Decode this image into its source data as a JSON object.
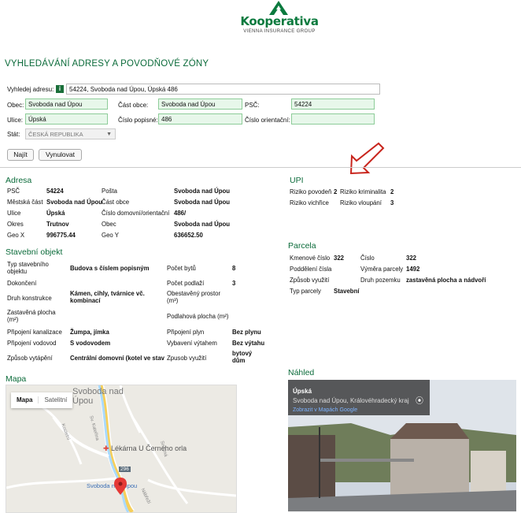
{
  "brand": {
    "name": "Kooperativa",
    "subtitle": "VIENNA INSURANCE GROUP",
    "accent": "#0b7a3e"
  },
  "page_title": "VYHLEDÁVÁNÍ ADRESY A POVODŇOVÉ ZÓNY",
  "search": {
    "address_label": "Vyhledej adresu:",
    "info_icon": "i",
    "address_value": "54224, Svoboda nad Úpou, Úpská 486",
    "obec_label": "Obec:",
    "obec_value": "Svoboda nad Úpou",
    "cast_obce_label": "Část obce:",
    "cast_obce_value": "Svoboda nad Úpou",
    "psc_label": "PSČ:",
    "psc_value": "54224",
    "ulice_label": "Ulice:",
    "ulice_value": "Úpská",
    "cislo_popisne_label": "Číslo popisné:",
    "cislo_popisne_value": "486",
    "cislo_orientacni_label": "Číslo orientační:",
    "cislo_orientacni_value": "",
    "stat_label": "Stát:",
    "stat_value": "ČESKÁ REPUBLIKA",
    "find_button": "Najít",
    "reset_button": "Vynulovat"
  },
  "adresa": {
    "title": "Adresa",
    "rows": [
      {
        "k1": "PSČ",
        "v1": "54224",
        "k2": "Pošta",
        "v2": "Svoboda nad Úpou"
      },
      {
        "k1": "Městská část",
        "v1": "Svoboda nad Úpou",
        "k2": "Část obce",
        "v2": "Svoboda nad Úpou"
      },
      {
        "k1": "Ulice",
        "v1": "Úpská",
        "k2": "Číslo domovní/orientační",
        "v2": "486/"
      },
      {
        "k1": "Okres",
        "v1": "Trutnov",
        "k2": "Obec",
        "v2": "Svoboda nad Úpou"
      },
      {
        "k1": "Geo X",
        "v1": "996775.44",
        "k2": "Geo Y",
        "v2": "636652.50"
      }
    ]
  },
  "upi": {
    "title": "UPI",
    "rows": [
      {
        "k1": "Riziko povodeň",
        "v1": "2",
        "k2": "Riziko kriminalita",
        "v2": "2"
      },
      {
        "k1": "Riziko vichřice",
        "v1": "",
        "k2": "Riziko vloupání",
        "v2": "3"
      }
    ]
  },
  "parcela": {
    "title": "Parcela",
    "rows": [
      {
        "k1": "Kmenové číslo",
        "v1": "322",
        "k2": "Číslo",
        "v2": "322"
      },
      {
        "k1": "Poddělení čísla",
        "v1": "",
        "k2": "Výměra parcely",
        "v2": "1492"
      },
      {
        "k1": "Způsob využití",
        "v1": "",
        "k2": "Druh pozemku",
        "v2": "zastavěná plocha a nádvoří"
      },
      {
        "k1": "Typ parcely",
        "v1": "Stavební",
        "k2": "",
        "v2": ""
      }
    ]
  },
  "stavebni": {
    "title": "Stavební objekt",
    "typ_label": "Typ stavebního objektu",
    "typ_value": "Budova s číslem popisným",
    "pocet_bytu_label": "Počet bytů",
    "pocet_bytu_value": "8",
    "dokonceni_label": "Dokončení",
    "pocet_podlazi_label": "Počet podlaží",
    "pocet_podlazi_value": "3",
    "druh_konstrukce_label": "Druh konstrukce",
    "druh_konstrukce_value": "Kámen, cihly, tvárnice vč. kombinací",
    "obestaveny_label": "Obestavěný prostor (m³)",
    "zastavena_label": "Zastavěná plocha (m²)",
    "podlahova_label": "Podlahová plocha (m²)",
    "kanalizace_label": "Připojení kanalizace",
    "kanalizace_value": "Žumpa, jímka",
    "plyn_label": "Připojení plyn",
    "plyn_value": "Bez plynu",
    "vodovod_label": "Připojení vodovod",
    "vodovod_value": "S vodovodem",
    "vytah_label": "Vybavení výtahem",
    "vytah_value": "Bez výtahu",
    "vytapeni_label": "Způsob vytápění",
    "vytapeni_value": "Centrální domovní (kotel ve stav",
    "vyuziti_label": "Zpusob využití",
    "vyuziti_value": "bytový dům"
  },
  "mapa": {
    "title": "Mapa",
    "tab_map": "Mapa",
    "tab_sat": "Satelitní",
    "place_label": "Svoboda nad Úpou",
    "pharmacy": "Lékárna U Černého orla",
    "road_number": "296",
    "small_place": "Svoboda nad Úpou",
    "street1": "Kostelní",
    "street2": "Sv. Kateřina",
    "street3": "Nábřeží",
    "street4": "Sněžná"
  },
  "nahled": {
    "title": "Náhled",
    "street": "Úpská",
    "region": "Svoboda nad Úpou, Královéhradecký kraj",
    "link": "Zobrazit v Mapách Google"
  }
}
